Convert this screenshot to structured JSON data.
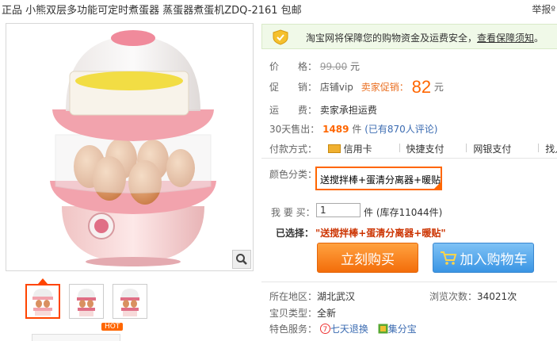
{
  "header": {
    "title": "正品 小熊双层多功能可定时煮蛋器 蒸蛋器煮蛋机ZDQ-2161 包邮",
    "report": "举报º"
  },
  "guarantee": {
    "text": "淘宝网将保障您的购物资金及运费安全，",
    "link": "查看保障须知",
    "end": "。"
  },
  "price": {
    "label": "价　　格：",
    "original": "99.00",
    "unit": "元"
  },
  "promo": {
    "label": "促　　销：",
    "tag1": "店铺vip",
    "tag2": "卖家促销：",
    "price": "82",
    "unit": "元"
  },
  "shipping": {
    "label": "运　　费：",
    "value": "卖家承担运费"
  },
  "sales": {
    "label": "30天售出：",
    "count": "1489",
    "unit": "件",
    "reviews": "(已有870人评论)"
  },
  "payment": {
    "label": "付款方式：",
    "methods": [
      "信用卡",
      "快捷支付",
      "网银支付",
      "找人代"
    ]
  },
  "color": {
    "label": "颜色分类：",
    "selected": "送搅拌棒+蛋清分离器+暖贴"
  },
  "quantity": {
    "label": "我 要 买：",
    "value": "1",
    "stock": "件 (库存11044件)"
  },
  "selected": {
    "label": "已选择：",
    "value": "\"送搅拌棒+蛋清分离器+暖贴\""
  },
  "buttons": {
    "buy": "立刻购买",
    "cart": "加入购物车"
  },
  "info": {
    "location_label": "所在地区：",
    "location": "湖北武汉",
    "views_label": "浏览次数：",
    "views": "34021次",
    "type_label": "宝贝类型：",
    "type": "全新",
    "service_label": "特色服务：",
    "service1": "七天退换",
    "service2": "集分宝"
  },
  "thumbs": {
    "hot": "HOT"
  },
  "colors": {
    "accent": "#ff6600",
    "buy": "#f36d0a",
    "cart": "#3a95e4",
    "guarantee_bg": "#f0f9e8"
  }
}
